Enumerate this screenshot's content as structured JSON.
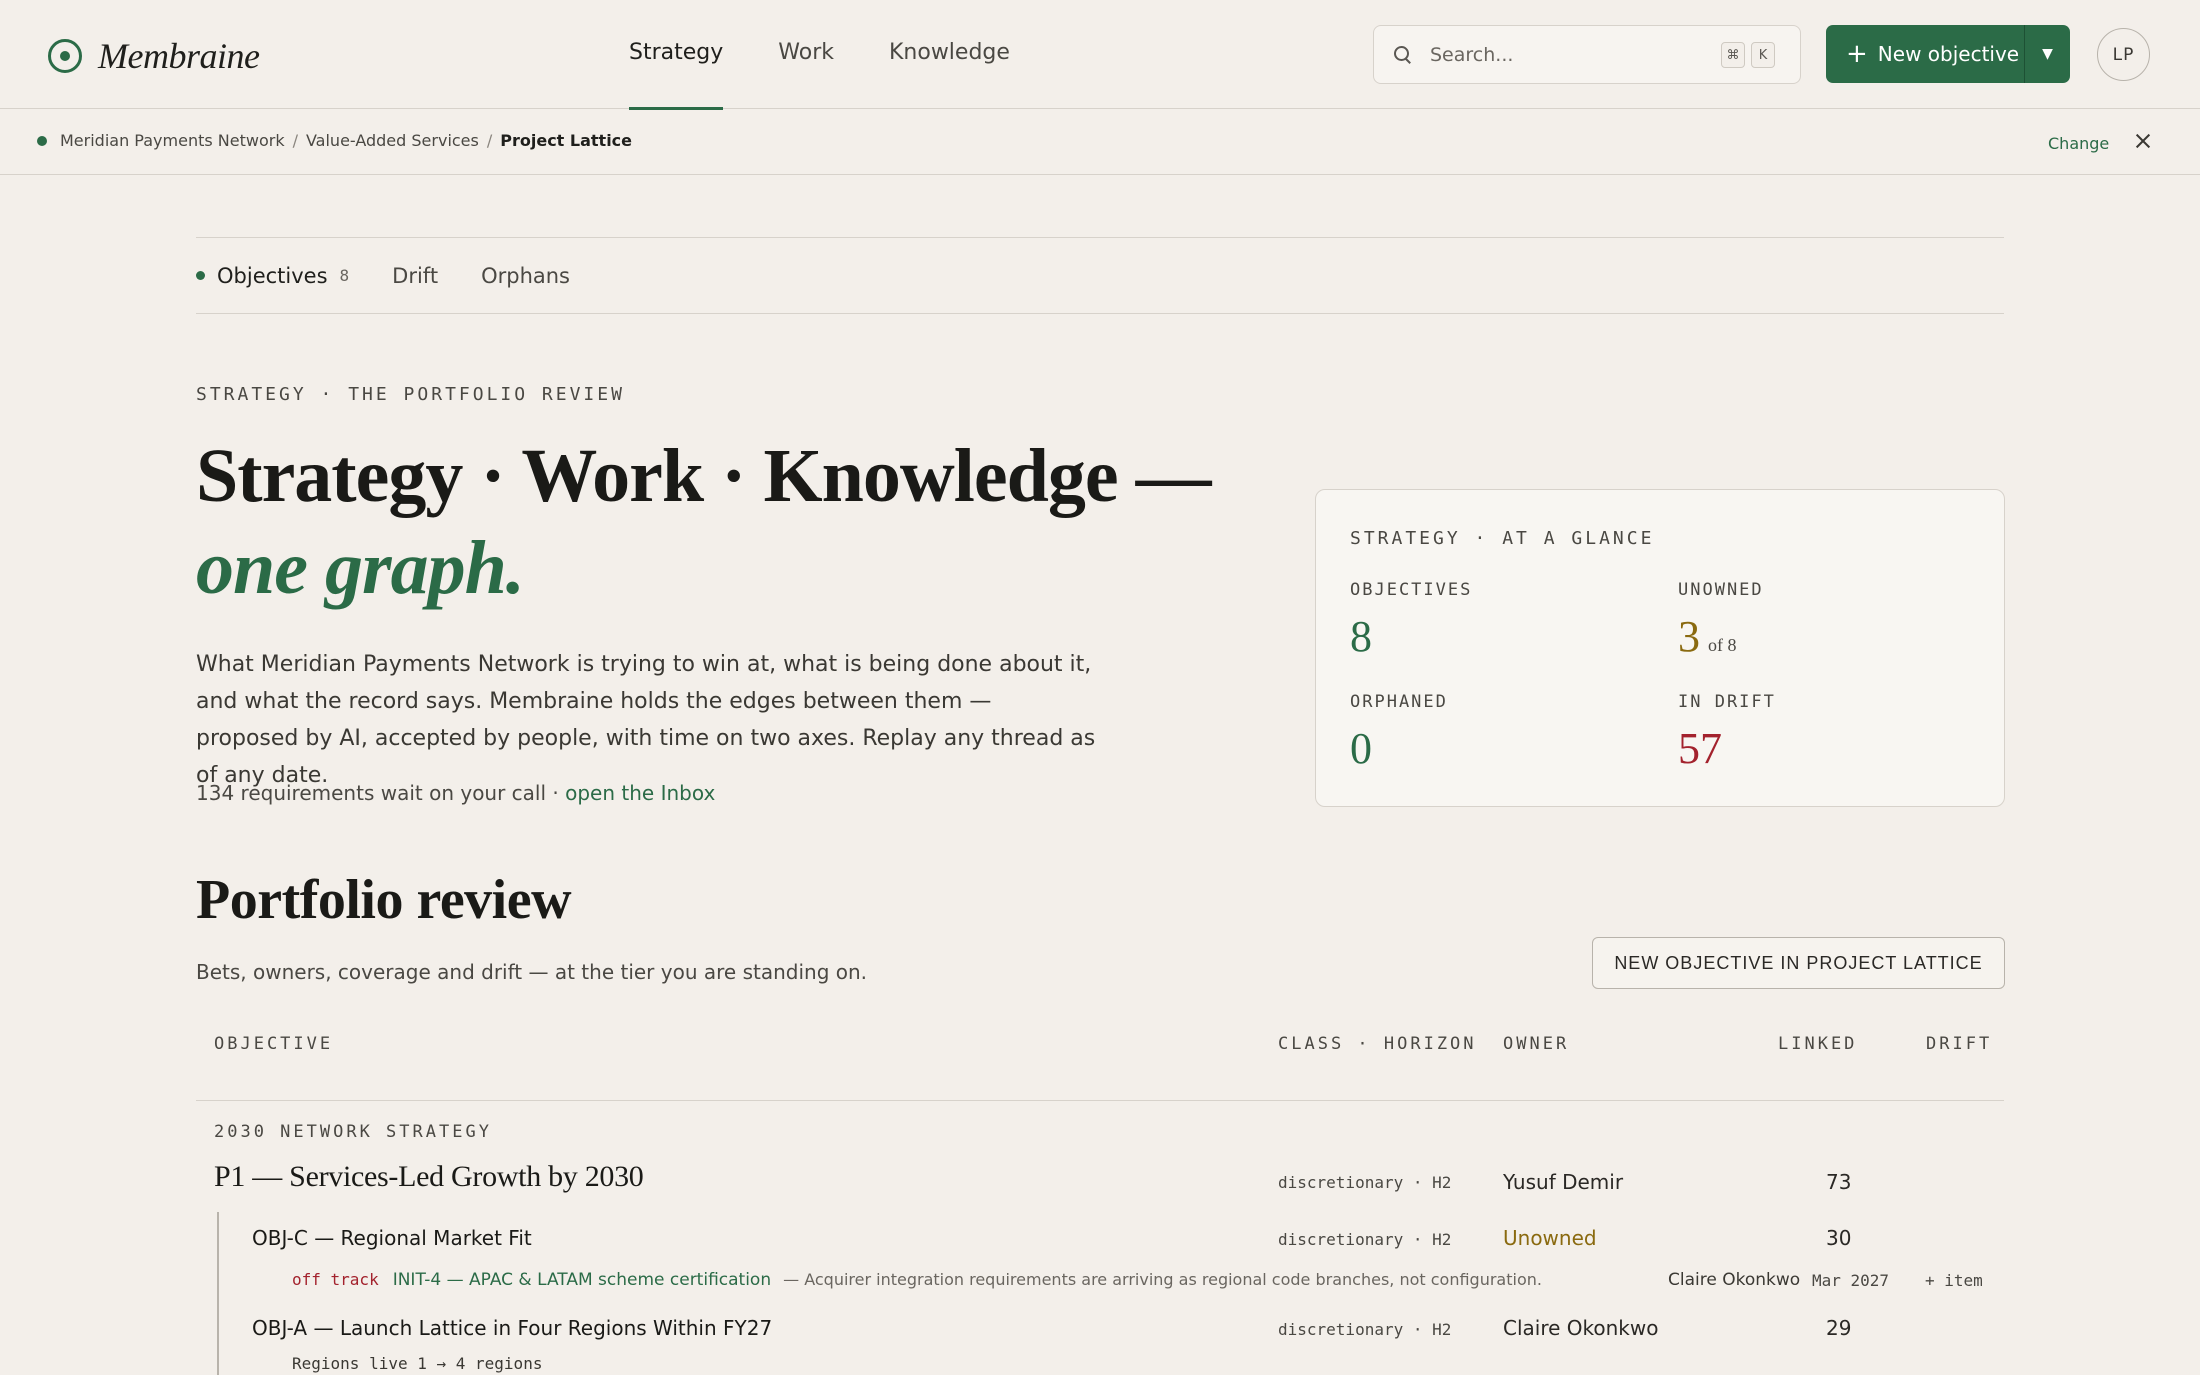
{
  "app": {
    "name": "Membraine"
  },
  "nav": {
    "items": [
      "Strategy",
      "Work",
      "Knowledge"
    ]
  },
  "search": {
    "placeholder": "Search...",
    "shortcut": [
      "⌘",
      "K"
    ]
  },
  "actions": {
    "new_objective": "New objective",
    "avatar": "LP"
  },
  "breadcrumb": {
    "items": [
      "Meridian Payments Network",
      "Value-Added Services",
      "Project Lattice"
    ],
    "separator": "/",
    "change": "Change"
  },
  "subtabs": [
    {
      "label": "Objectives",
      "count": "8"
    },
    {
      "label": "Drift"
    },
    {
      "label": "Orphans"
    }
  ],
  "hero": {
    "eyebrow": "STRATEGY · THE PORTFOLIO REVIEW",
    "headline": "Strategy · Work · Knowledge — ",
    "headline_em": "one graph.",
    "lede": "What Meridian Payments Network is trying to win at, what is being done about it, and what the record says. Membraine holds the edges between them — proposed by AI, accepted by people, with time on two axes. Replay any thread as of any date.",
    "inbox_text": "134 requirements wait on your call · ",
    "inbox_link": "open the Inbox"
  },
  "glance": {
    "title": "STRATEGY · AT A GLANCE",
    "objectives": {
      "label": "OBJECTIVES",
      "value": "8"
    },
    "unowned": {
      "label": "UNOWNED",
      "value": "3",
      "of": "of 8"
    },
    "orphaned": {
      "label": "ORPHANED",
      "value": "0"
    },
    "in_drift": {
      "label": "IN DRIFT",
      "value": "57"
    }
  },
  "portfolio": {
    "title": "Portfolio review",
    "subtitle": "Bets, owners, coverage and drift — at the tier you are standing on.",
    "new_button": "NEW OBJECTIVE IN  PROJECT LATTICE",
    "columns": {
      "objective": "OBJECTIVE",
      "class_horizon": "CLASS · HORIZON",
      "owner": "OWNER",
      "linked": "LINKED",
      "drift": "DRIFT"
    },
    "group": "2030 NETWORK STRATEGY",
    "rows": [
      {
        "title": "P1 — Services-Led Growth by 2030",
        "class": "discretionary · H2",
        "owner": "Yusuf Demir",
        "linked": "73"
      },
      {
        "title": "OBJ-C — Regional Market Fit",
        "class": "discretionary · H2",
        "owner": "Unowned",
        "linked": "30"
      },
      {
        "title": "OBJ-A — Launch Lattice in Four Regions Within FY27",
        "class": "discretionary · H2",
        "owner": "Claire Okonkwo",
        "linked": "29"
      }
    ],
    "initiative": {
      "status": "off track",
      "link": "INIT-4 — APAC & LATAM scheme certification",
      "note": "— Acquirer integration requirements are arriving as regional code branches, not configuration.",
      "owner": "Claire Okonkwo",
      "date": "Mar 2027",
      "add": "+ item"
    },
    "metric": "Regions live 1 → 4 regions"
  },
  "colors": {
    "accent": "#2b6b47",
    "warning": "#8a6a10",
    "danger": "#a3222d",
    "background": "#f3efea"
  }
}
